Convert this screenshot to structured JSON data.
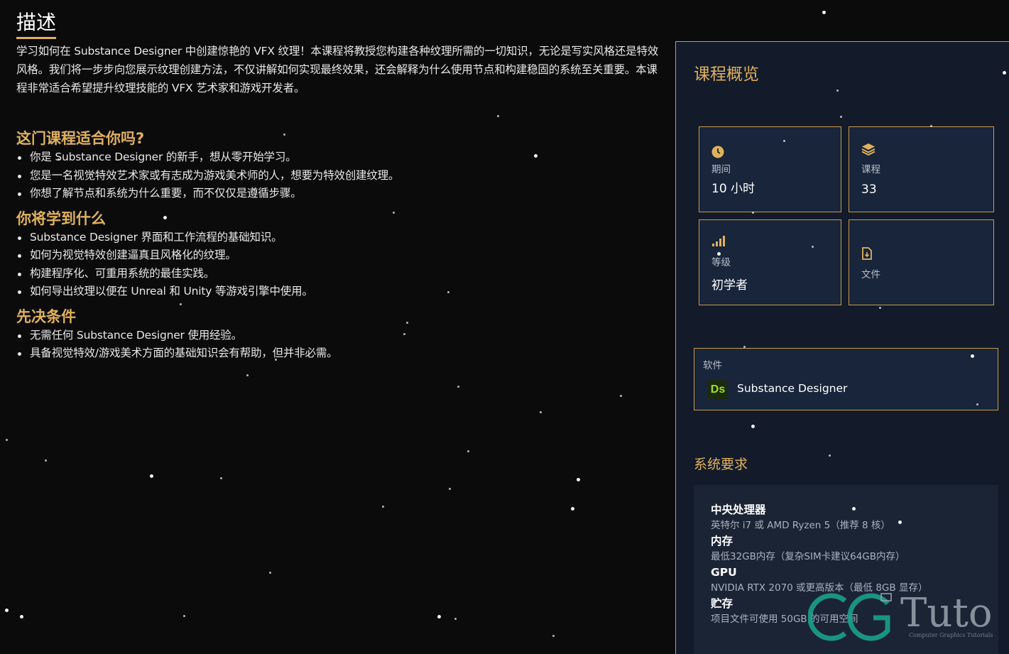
{
  "description": {
    "title": "描述",
    "text": "学习如何在 Substance Designer 中创建惊艳的 VFX 纹理！本课程将教授您构建各种纹理所需的一切知识，无论是写实风格还是特效风格。我们将一步步向您展示纹理创建方法，不仅讲解如何实现最终效果，还会解释为什么使用节点和构建稳固的系统至关重要。本课程非常适合希望提升纹理技能的 VFX 艺术家和游戏开发者。"
  },
  "sections": {
    "for_you": {
      "title": "这门课程适合你吗?",
      "items": [
        "你是 Substance Designer 的新手，想从零开始学习。",
        "您是一名视觉特效艺术家或有志成为游戏美术师的人，想要为特效创建纹理。",
        "你想了解节点和系统为什么重要，而不仅仅是遵循步骤。"
      ]
    },
    "learn": {
      "title": "你将学到什么",
      "items": [
        "Substance Designer 界面和工作流程的基础知识。",
        "如何为视觉特效创建逼真且风格化的纹理。",
        "构建程序化、可重用系统的最佳实践。",
        "如何导出纹理以便在 Unreal 和 Unity 等游戏引擎中使用。"
      ]
    },
    "prereq": {
      "title": "先决条件",
      "items": [
        "无需任何 Substance Designer 使用经验。",
        "具备视觉特效/游戏美术方面的基础知识会有帮助，但并非必需。"
      ]
    }
  },
  "overview": {
    "title": "课程概览",
    "stats": {
      "duration": {
        "icon": "clock-icon",
        "label": "期间",
        "value": "10 小时"
      },
      "lessons": {
        "icon": "layers-icon",
        "label": "课程",
        "value": "33"
      },
      "level": {
        "icon": "signal-bars-icon",
        "label": "等级",
        "value": "初学者"
      },
      "files": {
        "icon": "file-icon",
        "label": "文件",
        "value": ""
      }
    },
    "software": {
      "label": "软件",
      "logo_text": "Ds",
      "name": "Substance Designer"
    }
  },
  "system_requirements": {
    "title": "系统要求",
    "items": [
      {
        "title": "中央处理器",
        "text": "英特尔 i7 或 AMD Ryzen 5（推荐 8 核）"
      },
      {
        "title": "内存",
        "text": "最低32GB内存（复杂SIM卡建议64GB内存）"
      },
      {
        "title": "GPU",
        "text": "NVIDIA RTX 2070 或更高版本（最低 8GB 显存）"
      },
      {
        "title": "贮存",
        "text": "项目文件可使用 50GB 的可用空间"
      }
    ]
  },
  "watermark": {
    "brand": "Tuto",
    "tagline": "Computer Graphics Tutorials"
  },
  "colors": {
    "accent": "#e0b15c",
    "background": "#0b0b0c",
    "panel": "#131b2a",
    "card": "#18253a",
    "ds_green": "#9fe21f"
  }
}
